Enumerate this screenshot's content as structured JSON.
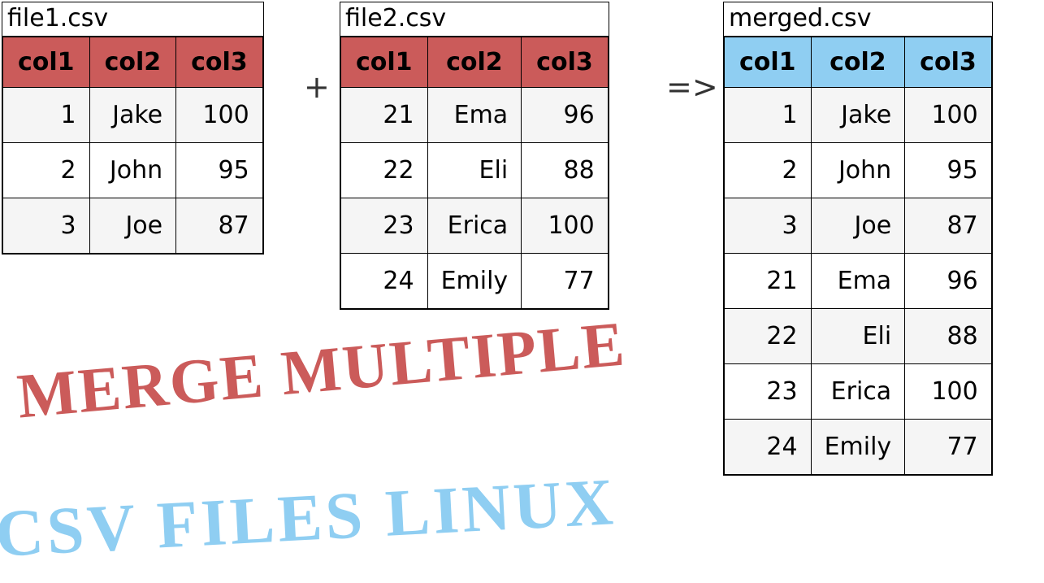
{
  "operators": {
    "plus": "+",
    "arrow": "=>"
  },
  "captions": {
    "line1": "MERGE MULTIPLE",
    "line2": "CSV FILES LINUX"
  },
  "tables": [
    {
      "title": "file1.csv",
      "header_style": "red",
      "columns": [
        "col1",
        "col2",
        "col3"
      ],
      "rows": [
        [
          "1",
          "Jake",
          "100"
        ],
        [
          "2",
          "John",
          "95"
        ],
        [
          "3",
          "Joe",
          "87"
        ]
      ]
    },
    {
      "title": "file2.csv",
      "header_style": "red",
      "columns": [
        "col1",
        "col2",
        "col3"
      ],
      "rows": [
        [
          "21",
          "Ema",
          "96"
        ],
        [
          "22",
          "Eli",
          "88"
        ],
        [
          "23",
          "Erica",
          "100"
        ],
        [
          "24",
          "Emily",
          "77"
        ]
      ]
    },
    {
      "title": "merged.csv",
      "header_style": "blue",
      "columns": [
        "col1",
        "col2",
        "col3"
      ],
      "rows": [
        [
          "1",
          "Jake",
          "100"
        ],
        [
          "2",
          "John",
          "95"
        ],
        [
          "3",
          "Joe",
          "87"
        ],
        [
          "21",
          "Ema",
          "96"
        ],
        [
          "22",
          "Eli",
          "88"
        ],
        [
          "23",
          "Erica",
          "100"
        ],
        [
          "24",
          "Emily",
          "77"
        ]
      ]
    }
  ],
  "chart_data": {
    "type": "table",
    "description": "Concatenation of two CSV tables into one merged table",
    "inputs": [
      {
        "name": "file1.csv",
        "columns": [
          "col1",
          "col2",
          "col3"
        ],
        "rows": [
          [
            1,
            "Jake",
            100
          ],
          [
            2,
            "John",
            95
          ],
          [
            3,
            "Joe",
            87
          ]
        ]
      },
      {
        "name": "file2.csv",
        "columns": [
          "col1",
          "col2",
          "col3"
        ],
        "rows": [
          [
            21,
            "Ema",
            96
          ],
          [
            22,
            "Eli",
            88
          ],
          [
            23,
            "Erica",
            100
          ],
          [
            24,
            "Emily",
            77
          ]
        ]
      }
    ],
    "output": {
      "name": "merged.csv",
      "columns": [
        "col1",
        "col2",
        "col3"
      ],
      "rows": [
        [
          1,
          "Jake",
          100
        ],
        [
          2,
          "John",
          95
        ],
        [
          3,
          "Joe",
          87
        ],
        [
          21,
          "Ema",
          96
        ],
        [
          22,
          "Eli",
          88
        ],
        [
          23,
          "Erica",
          100
        ],
        [
          24,
          "Emily",
          77
        ]
      ]
    }
  }
}
